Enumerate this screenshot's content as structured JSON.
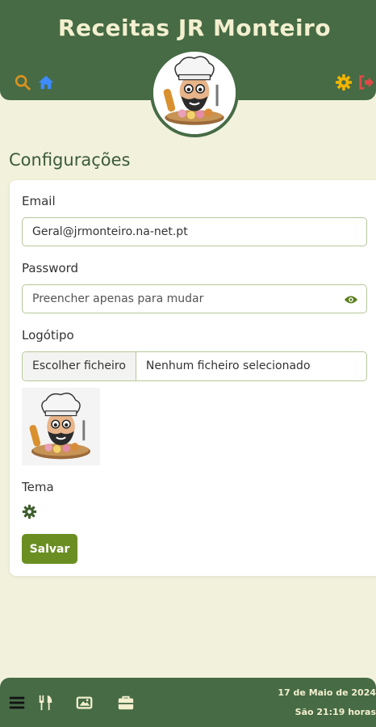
{
  "header": {
    "title": "Receitas JR Monteiro",
    "icons": [
      "search-icon",
      "home-icon",
      "settings-gear-icon",
      "logout-icon"
    ],
    "colors": {
      "bar": "#466b45",
      "search": "#d7921e",
      "home": "#3d8bfd",
      "gear": "#f0b400",
      "logout": "#e04848"
    }
  },
  "page": {
    "title": "Configurações"
  },
  "form": {
    "email_label": "Email",
    "email_value": "Geral@jrmonteiro.na-net.pt",
    "password_label": "Password",
    "password_placeholder": "Preencher apenas para mudar",
    "logo_label": "Logótipo",
    "file_button": "Escolher ficheiro",
    "file_status": "Nenhum ficheiro selecionado",
    "theme_label": "Tema",
    "save_button": "Salvar",
    "accent": "#6b8e23"
  },
  "footer": {
    "date": "17 de Maio de 2024",
    "time": "São 21:19 horas",
    "icons": [
      "menu-icon",
      "utensils-icon",
      "images-icon",
      "briefcase-icon"
    ]
  }
}
